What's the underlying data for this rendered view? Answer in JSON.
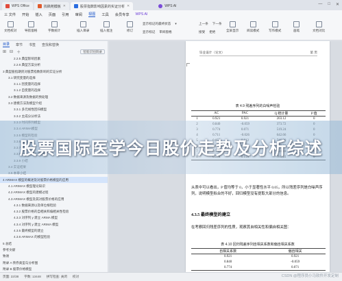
{
  "tabs": [
    {
      "label": "WPS Office",
      "color": "#e04a3c"
    },
    {
      "label": "找稿苑模板",
      "color": "#e05a2c"
    },
    {
      "label": "股票指数影响因素的实证分析",
      "color": "#2a6de0"
    },
    {
      "label": "WPS AI",
      "color": "#7a4bd8"
    }
  ],
  "window_controls": [
    "—",
    "□",
    "✕"
  ],
  "menu": [
    "三 文件",
    "开始",
    "插入",
    "页面",
    "引用",
    "审阅",
    "视图",
    "工具",
    "会员专享",
    "WPS AI"
  ],
  "menu_selected": "视图",
  "toolbar": {
    "buttons": [
      "文档校对",
      "导航窗格",
      "字数统计",
      "插入目录",
      "插入批注",
      "全屏显示",
      "阅读模式",
      "写作模式",
      "画笔",
      "文档对比"
    ],
    "row1": [
      "显示标记的最终状态",
      "上一条",
      "下一条"
    ],
    "row2": [
      "显示标记",
      "审阅窗格",
      "接受",
      "拒绝"
    ],
    "mode": "修订"
  },
  "sidebar": {
    "tabs": [
      "目录",
      "章节",
      "书签",
      "查找和替换"
    ],
    "active_tab": "目录",
    "smart_btn": "智能识别目录",
    "toc": [
      "2.2.5 典型影响因素",
      "2.2.6 典型方案分析",
      "3 典型股指期货对股票指数影响的实证分析",
      "3.1 研究变量的选择",
      "3.1.1 因变量的选择",
      "3.1.2 自变量的选择",
      "3.2 数据来源及数据的预处理",
      "3.3 建模方法及模型介绍",
      "3.3.1 多元线性回归模型",
      "3.3.2 主成分分析法",
      "3.3.3 时间序列模型",
      "3.3.4 ARIMA模型",
      "3.3.5 模型的检验",
      "3.3.6 结果分析",
      "3.3.7 实证小结",
      "3.3.8 ARIMA模型的优势",
      "3.3.9 小结",
      "3.4 实证结果",
      "3.5 本章小结",
      "4 ARIMAX 模型的概述及对股票价格模型的应用",
      "4.1 ARIMAX 模型理论知识",
      "4.2 ARIMAX 模型的建模过程",
      "4.3 ARIMAX 模型及其对股票价格的应用",
      "4.3.1 数据来源以及单位根检验",
      "4.3.2 股票价格的自相关和偏相关性检验",
      "4.3.3 对序列 y 建立 ARMA 模型",
      "4.3.4 对序列 y 建立 ARIMA 模型",
      "4.3.5 最终模型的建立",
      "4.3.6 ARIMAX 的模型检验",
      "5 总结",
      "参考文献",
      "致谢",
      "附录 A 债券类型与分析图",
      "附录 B 股票价格模型"
    ],
    "highlighted": "4 ARIMAX 模型的概述及对股票价格模型的应用"
  },
  "page": {
    "header_left": "毕业设计（论文）",
    "header_right": "第 页",
    "table1": {
      "caption": "表 4.9  残差序列的白噪声检验",
      "columns": [
        "",
        "AC",
        "PAC",
        "Q 统计量",
        "P 值"
      ],
      "rows": [
        [
          "1",
          "0.921",
          "0.921",
          "203.12",
          "0"
        ],
        [
          "2",
          "0.840",
          "-0.059",
          "373.72",
          "0"
        ],
        [
          "3",
          "0.774",
          "0.071",
          "519.24",
          "0"
        ],
        [
          "4",
          "0.711",
          "-0.026",
          "642.66",
          "0"
        ],
        [
          "5",
          "0.652",
          "0.012",
          "746.80",
          "0"
        ],
        [
          "6",
          "0.611",
          "0.050",
          "838.31",
          "0"
        ],
        [
          "7",
          "0.587",
          "0.044",
          "924.18",
          "0"
        ],
        [
          "8",
          "0.578",
          "0.018",
          "786.61",
          "0"
        ]
      ]
    },
    "para1": "从表中可以看出，P 值均等于 0，小于显著性水平 0.05，所以残差序列是白噪声序列，说明模型拟合的不好，回归模型没有提取大部分的信息。",
    "section": "4.3.5  最终模型的建立",
    "para2": "在考察回归残差序列的性质，观察其自相关性和偏自相关图：",
    "table2": {
      "caption": "表 4.10  回归残差序列自相关系数和偏自相关系数",
      "columns": [
        "自相关系数",
        "偏自相关"
      ],
      "rows": [
        [
          "0.921",
          "0.921"
        ],
        [
          "0.840",
          "-0.059"
        ],
        [
          "0.774",
          "0.071"
        ]
      ]
    }
  },
  "banner": "股票国际医学今日股价走势及分析综述",
  "status": {
    "page": "页面: 22/38",
    "words": "字数: 13448",
    "spell": "拼写检查: 关闭",
    "proof": "校对"
  },
  "watermark": "CSDN @程序员小马软件开发定制"
}
